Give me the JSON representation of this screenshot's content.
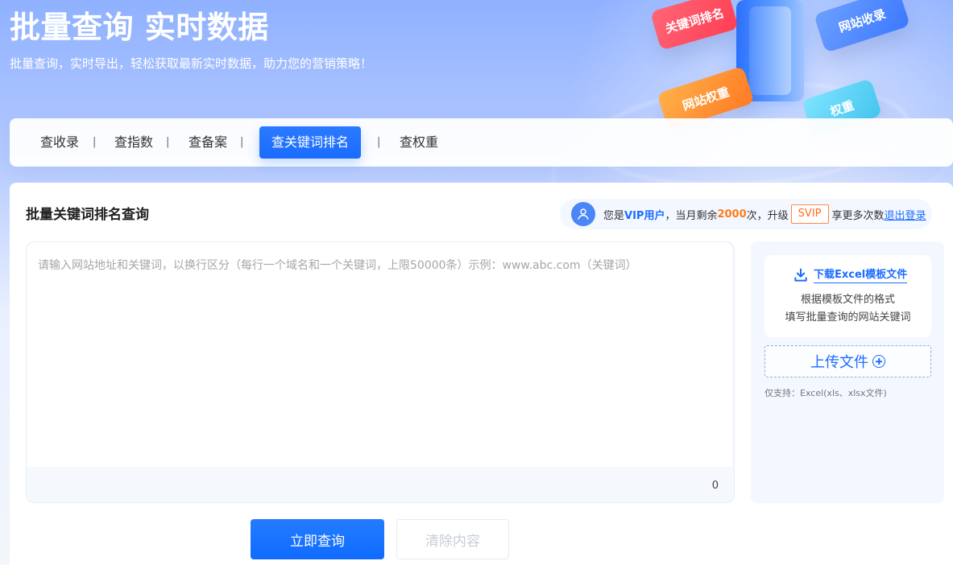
{
  "hero": {
    "title": "批量查询 实时数据",
    "subtitle": "批量查询，实时导出，轻松获取最新实时数据，助力您的营销策略！",
    "cards": [
      {
        "label": "关键词排名"
      },
      {
        "label": "网站收录"
      },
      {
        "label": "网站权重"
      },
      {
        "label": "权重"
      }
    ]
  },
  "nav": {
    "tabs": [
      {
        "label": "查收录"
      },
      {
        "label": "查指数"
      },
      {
        "label": "查备案"
      },
      {
        "label": "查关键词排名",
        "active": true
      },
      {
        "label": "查权重"
      }
    ],
    "separator": "|"
  },
  "main": {
    "section_title": "批量关键词排名查询",
    "vip": {
      "prefix": "您是",
      "user_type": "VIP用户",
      "middle": "，当月剩余 ",
      "remaining": "2000",
      "suffix": "次，升级",
      "svip_label": "SVIP",
      "after_svip": "享更多次数",
      "logout_label": "退出登录"
    },
    "query_input": {
      "value": "",
      "placeholder": "请输入网站地址和关键词，以换行区分（每行一个域名和一个关键词，上限50000条）示例：www.abc.com（关键词）",
      "char_count": "0"
    },
    "template": {
      "download_label": "下载Excel模板文件",
      "line1": "根据模板文件的格式",
      "line2": "填写批量查询的网站关键词"
    },
    "upload": {
      "button_label": "上传文件",
      "support_note": "仅支持：Excel(xls、xlsx文件)"
    },
    "actions": {
      "submit_label": "立即查询",
      "clear_label": "清除内容"
    }
  },
  "colors": {
    "primary": "#1a6cff",
    "orange": "#ff7b16",
    "text": "#333333"
  },
  "icons": {
    "avatar": "user-avatar-icon",
    "download": "download-icon",
    "upload": "plus-circle-icon"
  }
}
